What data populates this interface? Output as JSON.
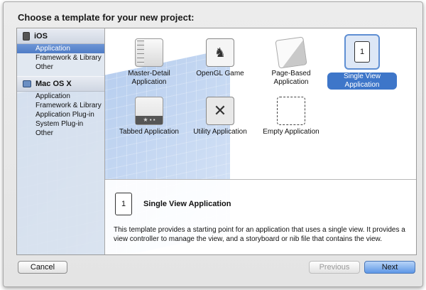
{
  "dialog": {
    "title": "Choose a template for your new project:"
  },
  "sidebar": {
    "sections": [
      {
        "name": "iOS",
        "icon": "iphone-icon",
        "items": [
          "Application",
          "Framework & Library",
          "Other"
        ],
        "selected": 0
      },
      {
        "name": "Mac OS X",
        "icon": "mac-icon",
        "items": [
          "Application",
          "Framework & Library",
          "Application Plug-in",
          "System Plug-in",
          "Other"
        ]
      }
    ]
  },
  "templates": [
    {
      "label": "Master-Detail Application",
      "icon": "master-detail-icon"
    },
    {
      "label": "OpenGL Game",
      "icon": "opengl-game-icon"
    },
    {
      "label": "Page-Based Application",
      "icon": "page-based-icon"
    },
    {
      "label": "Single View Application",
      "icon": "single-view-icon",
      "selected": true,
      "glyph": "1"
    },
    {
      "label": "Tabbed Application",
      "icon": "tabbed-icon"
    },
    {
      "label": "Utility Application",
      "icon": "utility-icon"
    },
    {
      "label": "Empty Application",
      "icon": "empty-icon"
    }
  ],
  "description": {
    "title": "Single View Application",
    "glyph": "1",
    "text": "This template provides a starting point for an application that uses a single view. It provides a view controller to manage the view, and a storyboard or nib file that contains the view."
  },
  "buttons": {
    "cancel": "Cancel",
    "previous": "Previous",
    "next": "Next"
  },
  "colors": {
    "selection": "#3e76c9",
    "sidebar_selection": "#5a86cc",
    "next_button": "#5e97e6"
  }
}
